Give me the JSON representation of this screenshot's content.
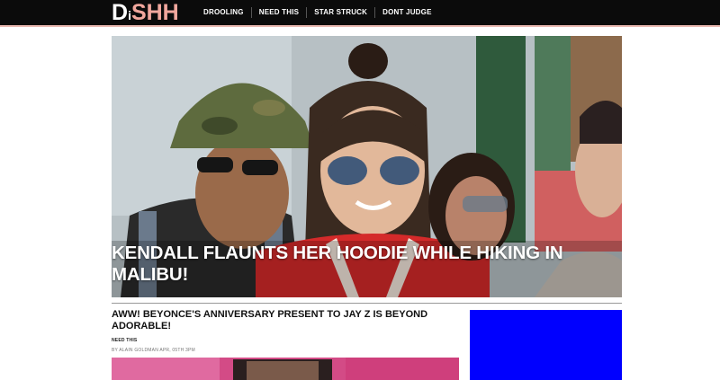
{
  "brand": {
    "logo_d": "D",
    "logo_i": "i",
    "logo_shh": "SHH"
  },
  "nav": {
    "items": [
      "DROOLING",
      "NEED THIS",
      "STAR STRUCK",
      "DONT JUDGE"
    ]
  },
  "hero": {
    "title": "KENDALL FLAUNTS HER HOODIE WHILE HIKING IN MALIBU!"
  },
  "article": {
    "title": "AWW! BEYONCE'S ANNIVERSARY PRESENT TO JAY Z IS BEYOND ADORABLE!",
    "category": "NEED THIS",
    "meta": "BY ALAIN GOLDMAN APR, 05TH 3PM"
  },
  "colors": {
    "topbar": "#0b0b0b",
    "logo_accent": "#f1a79d",
    "ad_block": "#0000ff",
    "jacket_red": "#d42a2a"
  }
}
